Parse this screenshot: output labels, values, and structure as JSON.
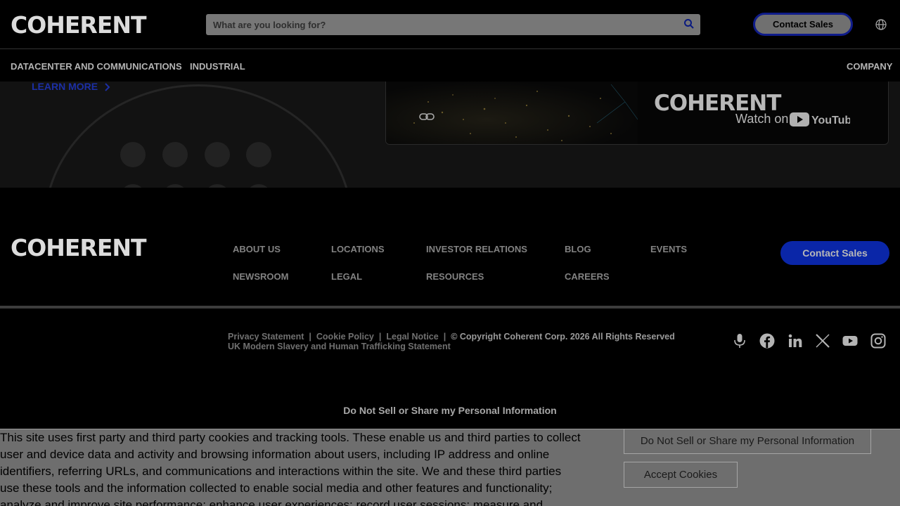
{
  "header": {
    "logo_text": "COHERENT",
    "search": {
      "placeholder": "What are you looking for?",
      "value": ""
    },
    "contact_label": "Contact Sales"
  },
  "nav": {
    "items": [
      {
        "label": "DATACENTER AND COMMUNICATIONS"
      },
      {
        "label": "INDUSTRIAL"
      },
      {
        "label": "COMPANY"
      }
    ]
  },
  "content": {
    "learn_more_label": "LEARN MORE",
    "video": {
      "logo_text": "COHERENT",
      "watch_on": "Watch on",
      "platform": "YouTube"
    }
  },
  "footer": {
    "logo_text": "COHERENT",
    "links": [
      {
        "label": "ABOUT US"
      },
      {
        "label": "LOCATIONS"
      },
      {
        "label": "INVESTOR RELATIONS"
      },
      {
        "label": "BLOG"
      },
      {
        "label": "EVENTS"
      },
      {
        "label": "NEWSROOM"
      },
      {
        "label": "LEGAL"
      },
      {
        "label": "RESOURCES"
      },
      {
        "label": "CAREERS"
      }
    ],
    "contact_label": "Contact Sales",
    "legal": {
      "privacy": "Privacy Statement",
      "cookie": "Cookie Policy",
      "notice": "Legal Notice",
      "copyright": "© Copyright Coherent Corp. 2026 All Rights Reserved",
      "slavery": "UK Modern Slavery and Human Trafficking Statement"
    },
    "social": [
      "podcast-icon",
      "facebook-icon",
      "linkedin-icon",
      "x-icon",
      "youtube-icon",
      "instagram-icon"
    ],
    "do_not_sell": "Do Not Sell or Share my Personal Information"
  },
  "cookie_banner": {
    "text": "This site uses first party and third party cookies and tracking tools. These enable us and third parties to collect user and device data and activity and browsing information about users, including IP address and online identifiers, referring URLs, and communications and interactions within the site. We and these third parties use these tools and the information collected to enable social media and other features and functionality; analyze and improve site performance; enhance user experiences; record user sessions; measure and improve marketing and ad campaigns;",
    "do_not_sell_label": "Do Not Sell or Share my Personal Information",
    "accept_label": "Accept Cookies"
  },
  "colors": {
    "background": "#000000",
    "accent_blue": "#0a26a8",
    "overlay_gray": "#6e6e6e"
  }
}
